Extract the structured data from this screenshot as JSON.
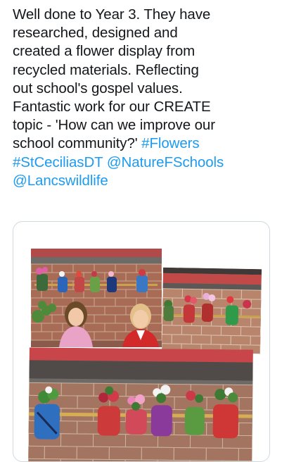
{
  "tweet": {
    "lines": [
      [
        {
          "t": "Well done to Year 3. They have"
        }
      ],
      [
        {
          "t": "researched, designed and"
        }
      ],
      [
        {
          "t": "created a flower display from"
        }
      ],
      [
        {
          "t": "recycled materials. Reflecting"
        }
      ],
      [
        {
          "t": "out school's gospel values."
        }
      ],
      [
        {
          "t": "Fantastic work for our CREATE"
        }
      ],
      [
        {
          "t": "topic - 'How can we improve our"
        }
      ],
      [
        {
          "t": "school community?' "
        },
        {
          "t": "#Flowers",
          "link": true
        }
      ],
      [
        {
          "t": "#StCeciliasDT",
          "link": true
        },
        {
          "t": " "
        },
        {
          "t": "@NatureFSchools",
          "link": true
        }
      ],
      [
        {
          "t": "@Lancswildlife",
          "link": true
        }
      ]
    ],
    "link_color": "#1d9bf0",
    "text_color": "#14171a"
  },
  "media": {
    "photos": [
      {
        "name": "photo-girls-flower-display"
      },
      {
        "name": "photo-wall-flower-pots"
      },
      {
        "name": "photo-bottle-planters-closeup"
      }
    ]
  }
}
